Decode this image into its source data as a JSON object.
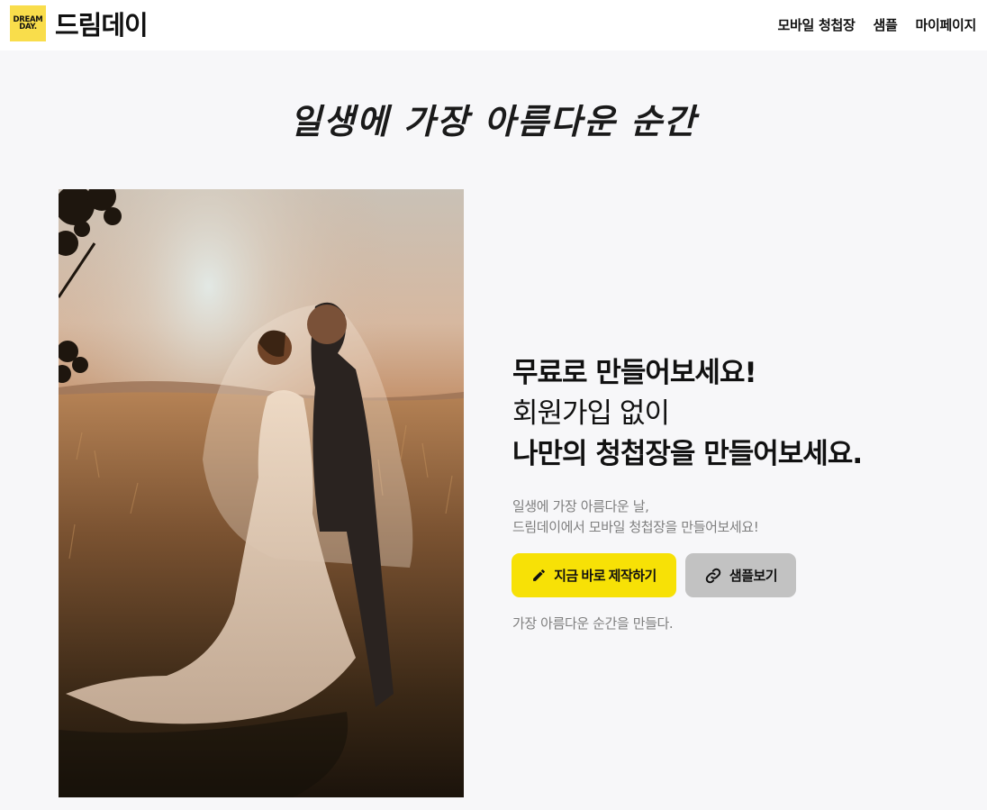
{
  "brand": {
    "logo_line1": "DREAM",
    "logo_line2": "DAY.",
    "name": "드림데이",
    "logo_color": "#f9dd4b"
  },
  "nav": {
    "items": [
      {
        "label": "모바일 청첩장"
      },
      {
        "label": "샘플"
      },
      {
        "label": "마이페이지"
      }
    ]
  },
  "tagline": "일생에 가장 아름다운 순간",
  "hero": {
    "headline_line1": "무료로 만들어보세요!",
    "headline_line2": "회원가입 없이",
    "headline_line3": "나만의 청첩장을 만들어보세요.",
    "description_line1": "일생에 가장 아름다운 날,",
    "description_line2": "드림데이에서 모바일 청첩장을 만들어보세요!",
    "primary_button": {
      "label": "지금 바로 제작하기",
      "icon": "pencil-icon",
      "color": "#f7e106"
    },
    "secondary_button": {
      "label": "샘플보기",
      "icon": "link-icon",
      "color": "#c2c2c2"
    },
    "slogan": "가장 아름다운 순간을 만들다."
  }
}
